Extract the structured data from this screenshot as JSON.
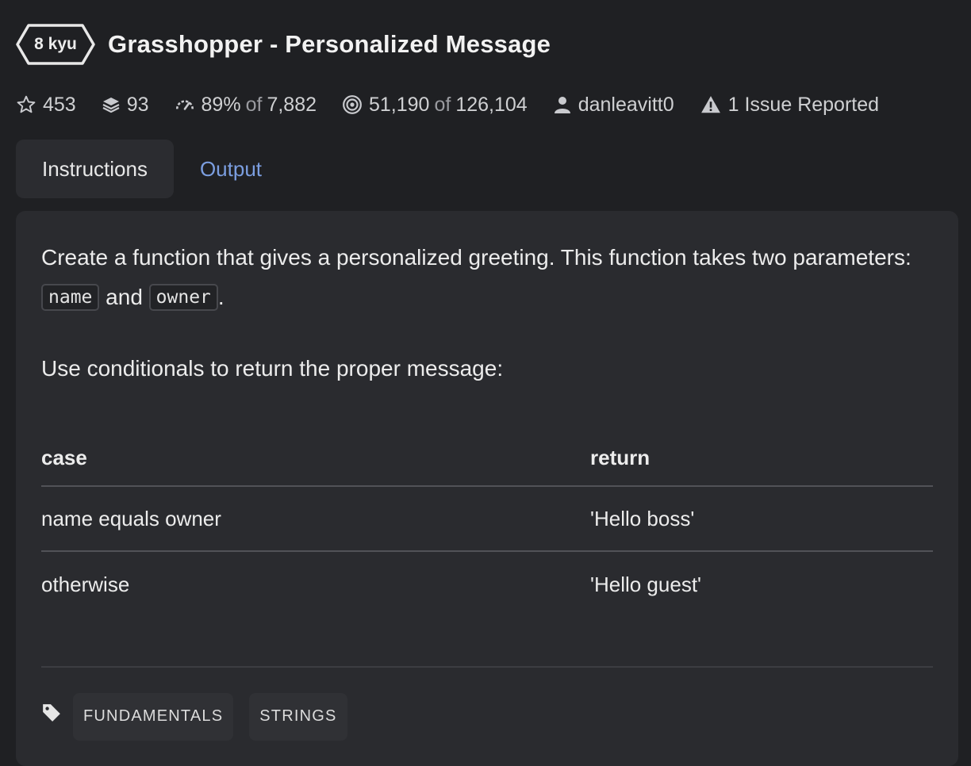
{
  "kata": {
    "rank": "8 kyu",
    "title": "Grasshopper - Personalized Message"
  },
  "stats": {
    "stars": "453",
    "collections": "93",
    "satisfaction_percent": "89%",
    "satisfaction_of": "of",
    "satisfaction_total": "7,882",
    "completed": "51,190",
    "completed_of": "of",
    "attempted": "126,104",
    "author": "danleavitt0",
    "issues": "1 Issue Reported"
  },
  "tabs": [
    {
      "label": "Instructions",
      "active": true
    },
    {
      "label": "Output",
      "active": false
    }
  ],
  "instructions": {
    "p1_text_a": "Create a function that gives a personalized greeting. This function takes two parameters:",
    "p1_code_1": "name",
    "p1_text_b": "and",
    "p1_code_2": "owner",
    "p1_text_c": ".",
    "p2": "Use conditionals to return the proper message:"
  },
  "table": {
    "headers": [
      "case",
      "return"
    ],
    "rows": [
      [
        "name equals owner",
        "'Hello boss'"
      ],
      [
        "otherwise",
        "'Hello guest'"
      ]
    ]
  },
  "tags": [
    "FUNDAMENTALS",
    "STRINGS"
  ],
  "icons": {
    "star": "star-icon",
    "collections": "layers-icon",
    "satisfaction": "gauge-icon",
    "completed": "target-icon",
    "author": "user-icon",
    "issues": "warning-icon",
    "tags": "tag-icon"
  },
  "colors": {
    "background": "#1f2023",
    "panel": "#2a2b2f",
    "link": "#7b9ee0",
    "text": "#ececec"
  }
}
